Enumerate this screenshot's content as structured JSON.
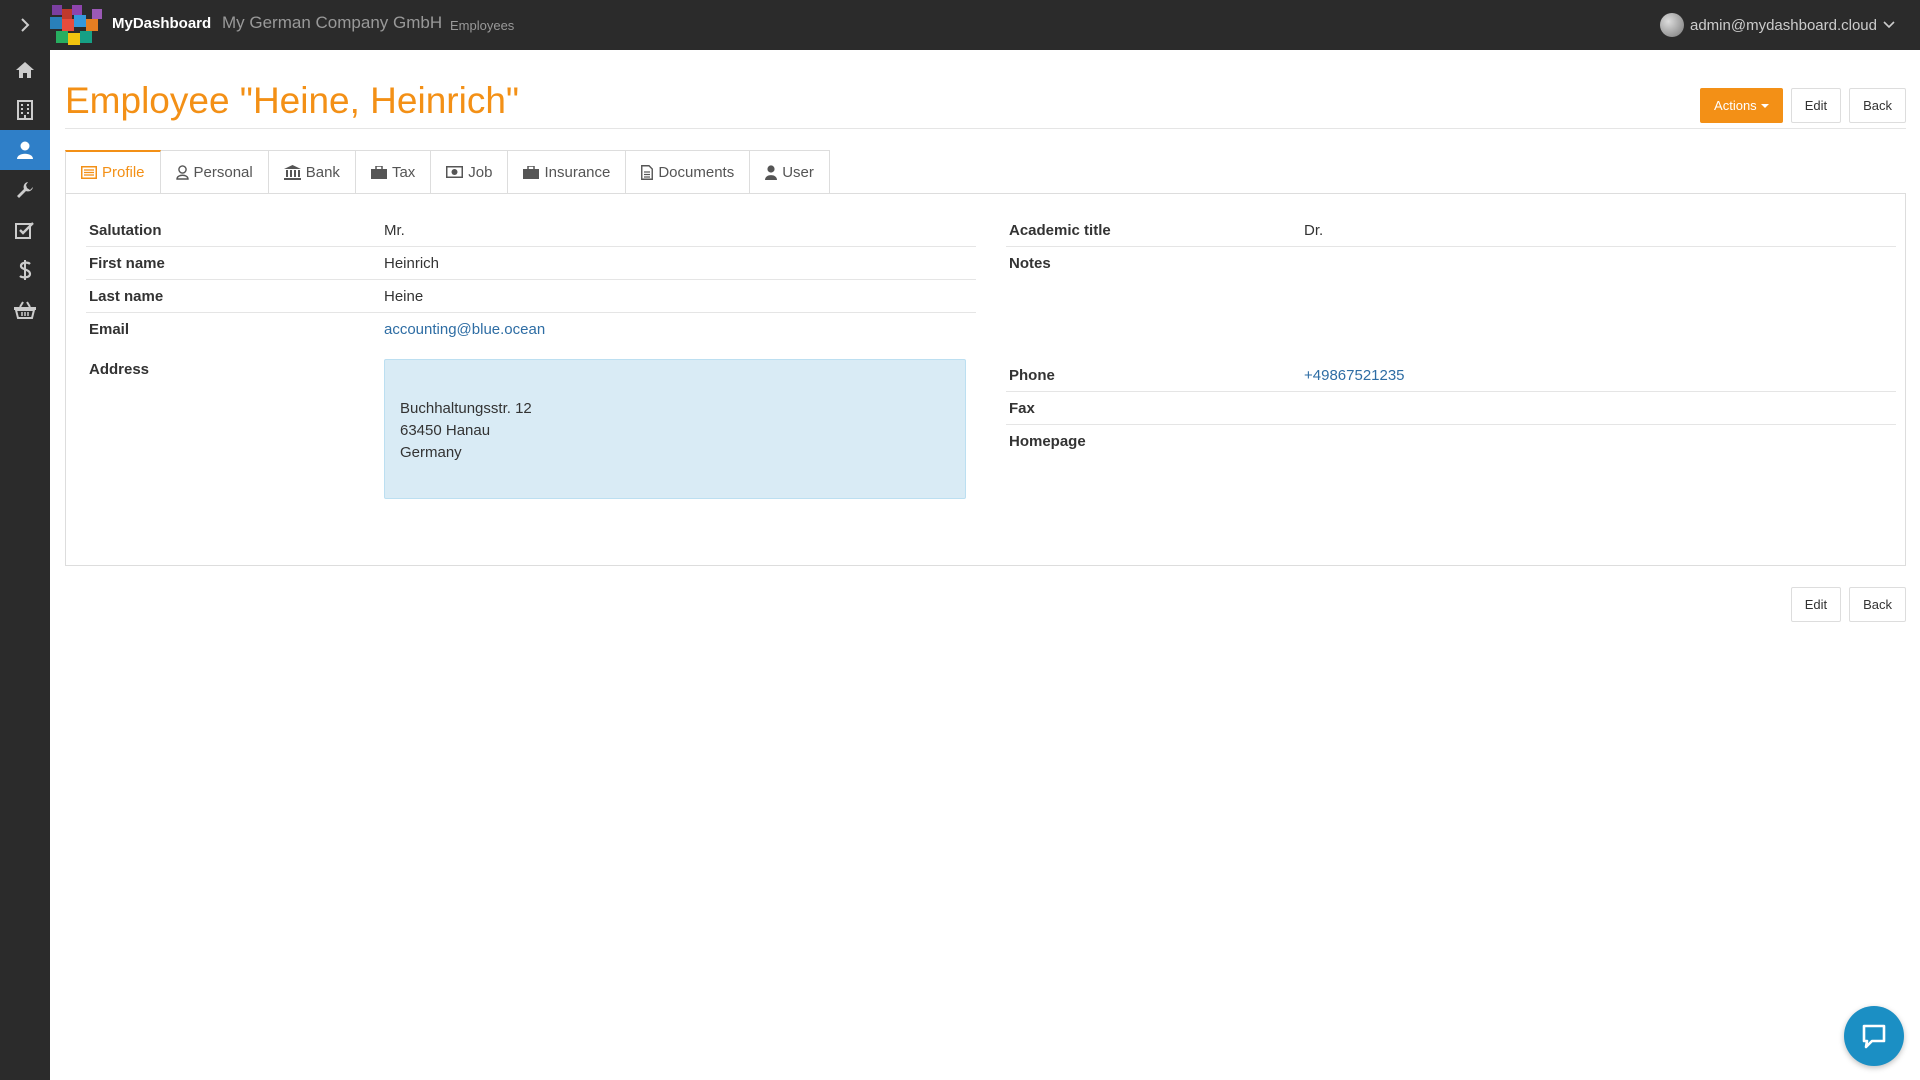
{
  "topbar": {
    "brand": "MyDashboard",
    "company": "My German Company GmbH",
    "breadcrumb": "Employees",
    "user_email": "admin@mydashboard.cloud"
  },
  "sidebar": {
    "items": [
      {
        "icon": "home-icon"
      },
      {
        "icon": "building-icon"
      },
      {
        "icon": "user-icon",
        "active": true
      },
      {
        "icon": "wrench-icon"
      },
      {
        "icon": "checkbox-icon"
      },
      {
        "icon": "dollar-icon"
      },
      {
        "icon": "basket-icon"
      }
    ]
  },
  "page": {
    "title": "Employee \"Heine, Heinrich\"",
    "actions_label": "Actions",
    "edit_label": "Edit",
    "back_label": "Back"
  },
  "tabs": [
    {
      "label": "Profile",
      "icon": "list-icon",
      "active": true
    },
    {
      "label": "Personal",
      "icon": "user-outline-icon"
    },
    {
      "label": "Bank",
      "icon": "bank-icon"
    },
    {
      "label": "Tax",
      "icon": "briefcase-icon"
    },
    {
      "label": "Job",
      "icon": "money-icon"
    },
    {
      "label": "Insurance",
      "icon": "briefcase-icon"
    },
    {
      "label": "Documents",
      "icon": "document-icon"
    },
    {
      "label": "User",
      "icon": "user-icon"
    }
  ],
  "profile": {
    "salutation": {
      "label": "Salutation",
      "value": "Mr."
    },
    "first_name": {
      "label": "First name",
      "value": "Heinrich"
    },
    "last_name": {
      "label": "Last name",
      "value": "Heine"
    },
    "email": {
      "label": "Email",
      "value": "accounting@blue.ocean"
    },
    "academic_title": {
      "label": "Academic title",
      "value": "Dr."
    },
    "notes": {
      "label": "Notes",
      "value": ""
    },
    "address": {
      "label": "Address",
      "line1": "Buchhaltungsstr. 12",
      "line2": "63450 Hanau",
      "line3": "Germany"
    },
    "phone": {
      "label": "Phone",
      "value": "+49867521235"
    },
    "fax": {
      "label": "Fax",
      "value": ""
    },
    "homepage": {
      "label": "Homepage",
      "value": ""
    }
  },
  "colors": {
    "accent": "#f39016",
    "sidebar_bg": "#2b2b2b",
    "active_nav": "#2f7fc8",
    "link": "#2e6da4",
    "address_bg": "#d9ebf5",
    "chat": "#1b8fc4"
  }
}
